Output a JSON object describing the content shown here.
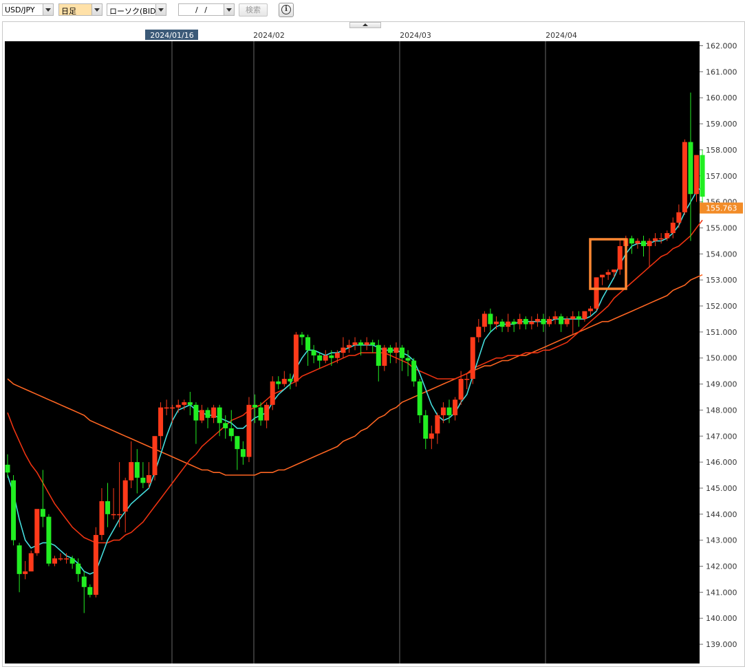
{
  "toolbar": {
    "pair": "USD/JPY",
    "timeframe": "日足",
    "chart_kind": "ローソク(BID)",
    "date_input": "/   /",
    "search_label": "検索",
    "info_label": "i"
  },
  "colors": {
    "background": "#000000",
    "up_candle": "#ff3a1a",
    "down_candle": "#22ee22",
    "ma_fast": "#44dddd",
    "ma_mid": "#ee3311",
    "ma_slow": "#ff6622",
    "price_tag": "#f28c28",
    "highlight_box": "#ff8833"
  },
  "chart_data": {
    "type": "candlestick",
    "instrument": "USD/JPY",
    "timeframe": "日足",
    "x_labels": [
      "2024/01/16",
      "2024/02",
      "2024/03",
      "2024/04"
    ],
    "highlighted_x_label": "2024/01/16",
    "y_ticks": [
      "162.000",
      "161.000",
      "160.000",
      "159.000",
      "158.000",
      "157.000",
      "156.000",
      "155.000",
      "154.000",
      "153.000",
      "152.000",
      "151.000",
      "150.000",
      "149.000",
      "148.000",
      "147.000",
      "146.000",
      "145.000",
      "144.000",
      "143.000",
      "142.000",
      "141.000",
      "140.000",
      "139.000"
    ],
    "ylim": [
      138.7,
      162.2
    ],
    "current_price": "155.763",
    "grid": "vertical lines at month labels",
    "candles": [
      [
        145.9,
        146.3,
        145.6,
        145.4
      ],
      [
        145.3,
        145.5,
        143.0,
        142.8
      ],
      [
        142.8,
        142.9,
        141.7,
        141.0
      ],
      [
        141.7,
        142.2,
        141.8,
        141.5
      ],
      [
        141.8,
        142.6,
        142.5,
        141.8
      ],
      [
        142.5,
        143.5,
        144.2,
        142.4
      ],
      [
        144.2,
        145.7,
        143.9,
        143.5
      ],
      [
        143.9,
        144.0,
        142.1,
        142.0
      ],
      [
        142.1,
        142.4,
        142.3,
        142.0
      ],
      [
        142.3,
        142.5,
        142.3,
        142.2
      ],
      [
        142.3,
        142.5,
        142.3,
        142.1
      ],
      [
        142.3,
        142.4,
        142.1,
        141.9
      ],
      [
        142.1,
        142.3,
        141.7,
        141.4
      ],
      [
        141.6,
        141.8,
        141.2,
        140.2
      ],
      [
        141.2,
        141.3,
        140.9,
        140.8
      ],
      [
        140.9,
        143.5,
        143.2,
        140.8
      ],
      [
        143.2,
        145.0,
        144.5,
        143.0
      ],
      [
        144.5,
        145.2,
        144.0,
        143.5
      ],
      [
        144.0,
        145.0,
        144.0,
        143.8
      ],
      [
        144.0,
        146.0,
        144.0,
        143.5
      ],
      [
        144.1,
        145.4,
        145.3,
        143.3
      ],
      [
        145.3,
        146.8,
        146.0,
        145.0
      ],
      [
        146.0,
        146.5,
        145.4,
        144.8
      ],
      [
        145.4,
        146.0,
        145.2,
        145.0
      ],
      [
        145.2,
        146.0,
        145.5,
        145.0
      ],
      [
        145.5,
        147.0,
        147.0,
        145.3
      ],
      [
        147.0,
        148.3,
        148.1,
        146.5
      ],
      [
        148.1,
        148.4,
        148.1,
        147.8
      ],
      [
        148.1,
        148.2,
        148.1,
        147.5
      ],
      [
        148.1,
        148.4,
        148.2,
        147.9
      ],
      [
        148.2,
        148.4,
        148.3,
        148.0
      ],
      [
        148.3,
        148.7,
        148.2,
        147.8
      ],
      [
        148.2,
        148.3,
        147.6,
        146.7
      ],
      [
        147.6,
        148.2,
        148.0,
        147.5
      ],
      [
        148.0,
        148.1,
        147.7,
        147.3
      ],
      [
        147.7,
        148.2,
        148.1,
        147.5
      ],
      [
        148.1,
        148.2,
        147.5,
        147.0
      ],
      [
        147.5,
        147.8,
        147.3,
        146.9
      ],
      [
        147.3,
        148.0,
        147.0,
        146.8
      ],
      [
        147.0,
        147.0,
        146.5,
        145.7
      ],
      [
        146.5,
        146.8,
        146.2,
        145.9
      ],
      [
        146.2,
        148.5,
        148.2,
        146.0
      ],
      [
        148.2,
        148.6,
        148.1,
        147.5
      ],
      [
        148.1,
        148.3,
        147.6,
        147.4
      ],
      [
        147.6,
        148.3,
        148.2,
        147.3
      ],
      [
        148.2,
        149.3,
        149.1,
        148.0
      ],
      [
        149.1,
        149.3,
        149.0,
        148.8
      ],
      [
        149.0,
        149.5,
        149.2,
        148.9
      ],
      [
        149.2,
        149.4,
        149.1,
        148.8
      ],
      [
        149.1,
        151.0,
        150.9,
        148.9
      ],
      [
        150.9,
        151.0,
        150.8,
        150.5
      ],
      [
        150.8,
        150.9,
        150.3,
        149.7
      ],
      [
        150.3,
        150.5,
        150.1,
        149.8
      ],
      [
        150.1,
        150.2,
        149.9,
        149.6
      ],
      [
        149.9,
        150.3,
        150.1,
        149.8
      ],
      [
        150.1,
        150.3,
        150.0,
        149.7
      ],
      [
        150.0,
        150.3,
        150.2,
        149.8
      ],
      [
        150.2,
        150.8,
        150.4,
        150.0
      ],
      [
        150.4,
        150.7,
        150.5,
        150.2
      ],
      [
        150.5,
        150.8,
        150.6,
        150.3
      ],
      [
        150.6,
        150.7,
        150.5,
        150.1
      ],
      [
        150.5,
        150.8,
        150.6,
        150.3
      ],
      [
        150.6,
        150.7,
        150.5,
        150.2
      ],
      [
        150.5,
        150.7,
        149.7,
        149.1
      ],
      [
        149.7,
        150.5,
        150.4,
        149.5
      ],
      [
        150.4,
        150.5,
        150.2,
        149.8
      ],
      [
        150.2,
        150.6,
        150.4,
        149.8
      ],
      [
        150.4,
        150.5,
        150.0,
        149.5
      ],
      [
        150.0,
        150.3,
        149.9,
        149.3
      ],
      [
        149.9,
        150.0,
        149.1,
        148.9
      ],
      [
        149.1,
        149.2,
        147.8,
        147.5
      ],
      [
        147.8,
        148.0,
        146.9,
        146.5
      ],
      [
        146.9,
        147.4,
        147.1,
        146.5
      ],
      [
        147.1,
        147.9,
        147.8,
        146.7
      ],
      [
        147.8,
        148.3,
        148.1,
        147.5
      ],
      [
        148.1,
        148.4,
        147.8,
        147.5
      ],
      [
        147.8,
        148.5,
        148.4,
        147.6
      ],
      [
        148.4,
        149.5,
        149.2,
        148.2
      ],
      [
        149.2,
        149.4,
        149.2,
        148.8
      ],
      [
        149.2,
        150.8,
        150.8,
        149.0
      ],
      [
        150.8,
        151.5,
        151.2,
        150.6
      ],
      [
        151.2,
        151.8,
        151.7,
        151.0
      ],
      [
        151.7,
        151.9,
        151.3,
        151.0
      ],
      [
        151.3,
        151.6,
        151.4,
        151.1
      ],
      [
        151.4,
        151.5,
        151.2,
        151.0
      ],
      [
        151.2,
        151.7,
        151.4,
        151.0
      ],
      [
        151.4,
        151.5,
        151.3,
        151.0
      ],
      [
        151.3,
        151.7,
        151.5,
        151.1
      ],
      [
        151.5,
        151.6,
        151.3,
        151.1
      ],
      [
        151.3,
        151.6,
        151.4,
        151.1
      ],
      [
        151.4,
        151.7,
        151.5,
        151.2
      ],
      [
        151.5,
        151.7,
        151.3,
        151.0
      ],
      [
        151.3,
        151.6,
        151.5,
        151.2
      ],
      [
        151.5,
        151.8,
        151.6,
        151.3
      ],
      [
        151.6,
        151.7,
        151.3,
        151.0
      ],
      [
        151.3,
        151.6,
        151.5,
        151.2
      ],
      [
        151.5,
        151.8,
        151.6,
        150.9
      ],
      [
        151.6,
        151.8,
        151.5,
        151.2
      ],
      [
        151.5,
        151.8,
        151.8,
        151.4
      ],
      [
        151.8,
        152.0,
        151.9,
        151.6
      ],
      [
        151.9,
        153.1,
        153.1,
        151.8
      ],
      [
        153.1,
        153.2,
        153.2,
        152.8
      ],
      [
        153.2,
        153.4,
        153.3,
        153.0
      ],
      [
        153.3,
        153.4,
        153.4,
        153.1
      ],
      [
        153.4,
        154.6,
        154.3,
        153.2
      ],
      [
        154.3,
        154.7,
        154.6,
        154.1
      ],
      [
        154.6,
        154.7,
        154.4,
        154.0
      ],
      [
        154.4,
        154.6,
        154.5,
        154.2
      ],
      [
        154.5,
        154.7,
        154.3,
        153.9
      ],
      [
        154.3,
        154.6,
        154.5,
        153.5
      ],
      [
        154.5,
        154.8,
        154.6,
        154.3
      ],
      [
        154.6,
        154.8,
        154.6,
        154.4
      ],
      [
        154.6,
        154.9,
        154.8,
        154.5
      ],
      [
        154.8,
        155.4,
        155.2,
        154.6
      ],
      [
        155.2,
        155.9,
        155.6,
        155.0
      ],
      [
        155.6,
        158.4,
        158.3,
        155.5
      ],
      [
        158.3,
        160.2,
        156.3,
        154.5
      ],
      [
        156.3,
        157.8,
        157.8,
        156.0
      ],
      [
        157.8,
        158.0,
        156.2,
        155.9
      ]
    ],
    "ma_fast": [
      145.5,
      144.8,
      143.8,
      143.0,
      142.7,
      142.8,
      142.9,
      142.9,
      142.8,
      142.6,
      142.4,
      142.3,
      142.1,
      141.8,
      141.7,
      141.8,
      142.4,
      143.0,
      143.4,
      143.8,
      144.1,
      144.4,
      144.6,
      144.8,
      145.0,
      145.6,
      146.3,
      147.0,
      147.6,
      148.0,
      148.1,
      148.2,
      148.0,
      147.9,
      147.8,
      147.8,
      147.7,
      147.6,
      147.5,
      147.3,
      147.3,
      147.5,
      147.7,
      147.8,
      147.9,
      148.3,
      148.6,
      148.8,
      149.0,
      149.6,
      150.0,
      150.3,
      150.3,
      150.2,
      150.1,
      150.2,
      150.2,
      150.3,
      150.4,
      150.5,
      150.5,
      150.5,
      150.5,
      150.4,
      150.3,
      150.3,
      150.3,
      150.2,
      150.1,
      149.9,
      149.4,
      148.8,
      148.2,
      147.8,
      147.6,
      147.7,
      147.9,
      148.3,
      148.6,
      149.3,
      150.0,
      150.7,
      151.0,
      151.2,
      151.3,
      151.3,
      151.3,
      151.4,
      151.4,
      151.4,
      151.4,
      151.4,
      151.4,
      151.5,
      151.5,
      151.5,
      151.5,
      151.5,
      151.5,
      151.6,
      151.8,
      152.3,
      152.7,
      153.1,
      153.6,
      154.0,
      154.3,
      154.4,
      154.4,
      154.4,
      154.5,
      154.5,
      154.6,
      154.8,
      155.1,
      155.6,
      156.0,
      156.4,
      156.6
    ],
    "ma_mid": [
      147.9,
      147.3,
      146.8,
      146.3,
      145.9,
      145.6,
      145.2,
      144.8,
      144.4,
      144.1,
      143.8,
      143.5,
      143.3,
      143.1,
      143.0,
      142.9,
      142.9,
      142.9,
      143.0,
      143.0,
      143.2,
      143.3,
      143.5,
      143.7,
      144.0,
      144.3,
      144.6,
      144.9,
      145.2,
      145.5,
      145.8,
      146.1,
      146.3,
      146.6,
      146.8,
      147.0,
      147.2,
      147.4,
      147.6,
      147.7,
      147.8,
      148.0,
      148.1,
      148.2,
      148.4,
      148.6,
      148.7,
      148.8,
      149.0,
      149.1,
      149.3,
      149.4,
      149.5,
      149.6,
      149.7,
      149.8,
      149.9,
      150.0,
      150.1,
      150.1,
      150.2,
      150.2,
      150.2,
      150.2,
      150.2,
      150.1,
      150.0,
      149.9,
      149.8,
      149.6,
      149.5,
      149.4,
      149.3,
      149.2,
      149.2,
      149.2,
      149.2,
      149.3,
      149.4,
      149.6,
      149.7,
      149.8,
      149.9,
      150.0,
      150.0,
      150.1,
      150.1,
      150.1,
      150.2,
      150.2,
      150.2,
      150.3,
      150.3,
      150.4,
      150.5,
      150.6,
      150.8,
      151.0,
      151.2,
      151.4,
      151.6,
      151.8,
      152.0,
      152.3,
      152.5,
      152.7,
      152.9,
      153.1,
      153.3,
      153.5,
      153.7,
      153.9,
      154.0,
      154.2,
      154.3,
      154.5,
      154.7,
      155.0,
      155.3
    ],
    "ma_slow": [
      149.2,
      149.0,
      148.9,
      148.8,
      148.7,
      148.6,
      148.5,
      148.4,
      148.3,
      148.2,
      148.1,
      148.0,
      147.9,
      147.8,
      147.6,
      147.5,
      147.4,
      147.3,
      147.2,
      147.1,
      147.0,
      146.9,
      146.8,
      146.7,
      146.6,
      146.5,
      146.4,
      146.3,
      146.2,
      146.1,
      146.0,
      145.9,
      145.8,
      145.7,
      145.7,
      145.6,
      145.6,
      145.5,
      145.5,
      145.5,
      145.5,
      145.5,
      145.5,
      145.6,
      145.6,
      145.6,
      145.7,
      145.7,
      145.8,
      145.9,
      146.0,
      146.1,
      146.2,
      146.3,
      146.4,
      146.5,
      146.6,
      146.8,
      146.9,
      147.0,
      147.2,
      147.3,
      147.5,
      147.7,
      147.8,
      148.0,
      148.1,
      148.3,
      148.4,
      148.5,
      148.6,
      148.7,
      148.8,
      148.9,
      149.0,
      149.1,
      149.2,
      149.3,
      149.4,
      149.5,
      149.6,
      149.7,
      149.7,
      149.8,
      149.9,
      149.9,
      150.0,
      150.1,
      150.1,
      150.2,
      150.3,
      150.4,
      150.5,
      150.6,
      150.7,
      150.8,
      150.9,
      151.0,
      151.1,
      151.2,
      151.3,
      151.4,
      151.4,
      151.5,
      151.6,
      151.7,
      151.8,
      151.9,
      152.0,
      152.1,
      152.2,
      152.3,
      152.4,
      152.6,
      152.7,
      152.8,
      153.0,
      153.1,
      153.2
    ]
  }
}
